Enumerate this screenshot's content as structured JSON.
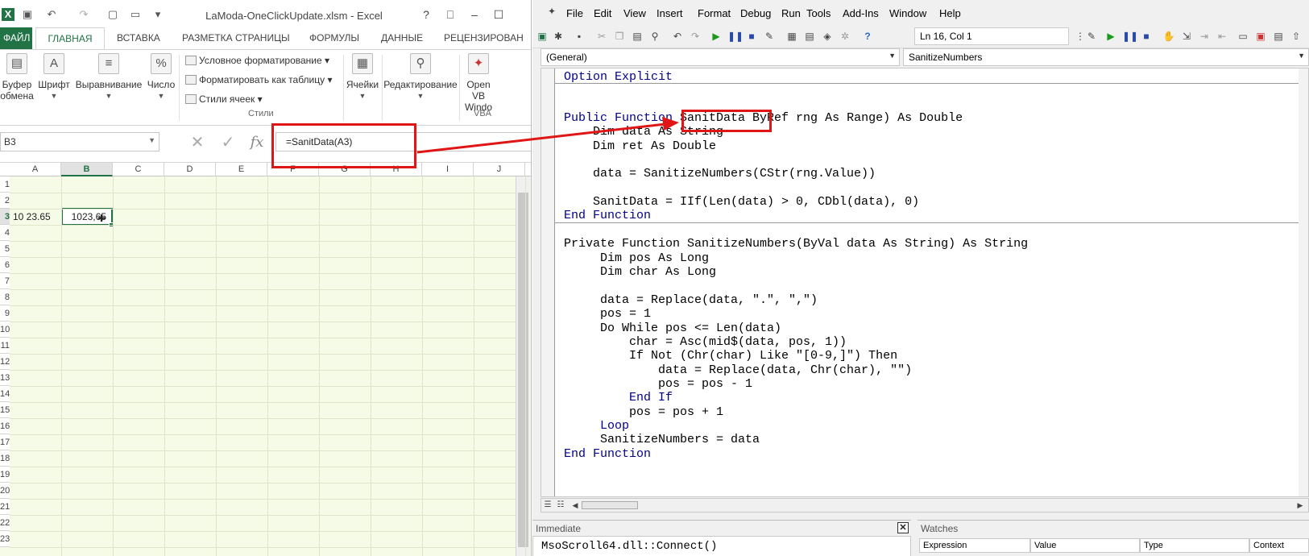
{
  "excel": {
    "title": "LaModa-OneClickUpdate.xlsm - Excel",
    "qat": [
      "save-icon",
      "undo-icon",
      "redo-icon",
      "new-icon",
      "open-icon",
      "customize-icon"
    ],
    "window_buttons": [
      "?",
      "⎕",
      "–",
      "☐"
    ],
    "tabs": [
      "ФАЙЛ",
      "ГЛАВНАЯ",
      "ВСТАВКА",
      "РАЗМЕТКА СТРАНИЦЫ",
      "ФОРМУЛЫ",
      "ДАННЫЕ",
      "РЕЦЕНЗИРОВАН"
    ],
    "ribbon": {
      "clipboard": [
        "Буфер",
        "обмена"
      ],
      "font": "Шрифт",
      "alignment": "Выравнивание",
      "number": "Число",
      "styles_items": [
        "Условное форматирование",
        "Форматировать как таблицу",
        "Стили ячеек"
      ],
      "styles_caption": "Стили",
      "cells": "Ячейки",
      "editing": "Редактирование",
      "vba_buttons": [
        "Open VB",
        "Windo"
      ],
      "vba_caption": "VBA"
    },
    "namebox": "B3",
    "formula": "=SanitData(A3)",
    "columns": [
      "A",
      "B",
      "C",
      "D",
      "E",
      "F",
      "G",
      "H",
      "I",
      "J"
    ],
    "rows": [
      "1",
      "2",
      "3",
      "4",
      "5",
      "6",
      "7",
      "8",
      "9",
      "10",
      "11",
      "12",
      "13",
      "14",
      "15",
      "16",
      "17",
      "18",
      "19",
      "20",
      "21",
      "22",
      "23"
    ],
    "cell_a3": "10 23.65",
    "cell_b3": "1023,65"
  },
  "vbe": {
    "menu": [
      "File",
      "Edit",
      "View",
      "Insert",
      "Format",
      "Debug",
      "Run",
      "Tools",
      "Add-Ins",
      "Window",
      "Help"
    ],
    "cursor_position": "Ln 16, Col 1",
    "object_box": "(General)",
    "procedure_box": "SanitizeNumbers",
    "code": {
      "l1": "Option Explicit",
      "l2_a": "Public Function ",
      "l2_name": "SanitData",
      "l2_b": " ByRef rng As Range) As Double",
      "l3": "    Dim data As String",
      "l4": "    Dim ret As Double",
      "l5": "    data = SanitizeNumbers(CStr(rng.Value))",
      "l6": "    SanitData = IIf(Len(data) > 0, CDbl(data), 0)",
      "l7": "End Function",
      "l8": "Private Function SanitizeNumbers(ByVal data As String) As String",
      "l9": "     Dim pos As Long",
      "l10": "     Dim char As Long",
      "l11": "     data = Replace(data, \".\", \",\")",
      "l12": "     pos = 1",
      "l13": "     Do While pos <= Len(data)",
      "l14": "         char = Asc(mid$(data, pos, 1))",
      "l15": "         If Not (Chr(char) Like \"[0-9,]\") Then",
      "l16": "             data = Replace(data, Chr(char), \"\")",
      "l17": "             pos = pos - 1",
      "l18": "         End If",
      "l19": "         pos = pos + 1",
      "l20": "     Loop",
      "l21": "     SanitizeNumbers = data",
      "l22": "End Function"
    },
    "immediate": {
      "title": "Immediate",
      "content": "MsoScroll64.dll::Connect()"
    },
    "watches": {
      "title": "Watches",
      "columns": [
        "Expression",
        "Value",
        "Type",
        "Context"
      ]
    }
  },
  "colors": {
    "excel_green": "#217346",
    "annotation_red": "#e01616",
    "vba_keyword": "#00008b"
  }
}
